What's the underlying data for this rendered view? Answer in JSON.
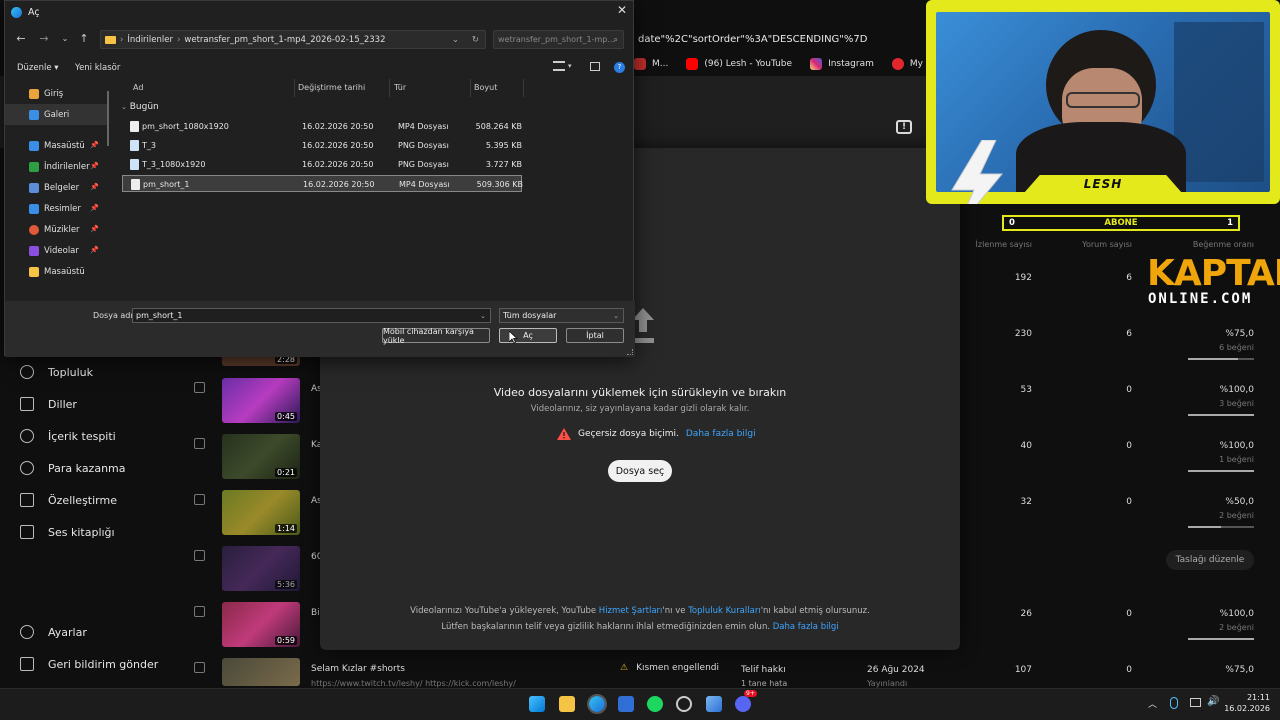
{
  "browser": {
    "url_fragment": "date\"%2C\"sortOrder\"%3A\"DESCENDING\"%7D",
    "bookmarks": [
      {
        "label": "M...",
        "color": "#c4302b"
      },
      {
        "label": "(96) Lesh - YouTube",
        "color": "#ff0000"
      },
      {
        "label": "Instagram",
        "color": "#d62976"
      },
      {
        "label": "My Blerps Dashboa...",
        "color": "#e3262e"
      }
    ]
  },
  "left_nav": {
    "items": [
      {
        "label": "Topluluk",
        "icon": "community-icon"
      },
      {
        "label": "Diller",
        "icon": "subtitles-icon"
      },
      {
        "label": "İçerik tespiti",
        "icon": "copyright-icon"
      },
      {
        "label": "Para kazanma",
        "icon": "dollar-icon"
      },
      {
        "label": "Özelleştirme",
        "icon": "customize-icon"
      },
      {
        "label": "Ses kitaplığı",
        "icon": "audio-library-icon"
      }
    ],
    "settings": "Ayarlar",
    "feedback": "Geri bildirim gönder"
  },
  "content_rows": [
    {
      "duration": "2:28",
      "title": "",
      "views": "230",
      "comments": "6",
      "ratio": "%75,0",
      "likes": "6 beğeni",
      "ratio_value": 0.75
    },
    {
      "duration": "0:45",
      "title": "As",
      "views": "53",
      "comments": "0",
      "ratio": "%100,0",
      "likes": "3 beğeni",
      "ratio_value": 1.0
    },
    {
      "duration": "0:21",
      "title": "Ka",
      "views": "40",
      "comments": "0",
      "ratio": "%100,0",
      "likes": "1 beğeni",
      "ratio_value": 1.0
    },
    {
      "duration": "1:14",
      "title": "As",
      "views": "32",
      "comments": "0",
      "ratio": "%50,0",
      "likes": "2 beğeni",
      "ratio_value": 0.5
    },
    {
      "duration": "5:36",
      "title": "60",
      "views": "",
      "comments": "",
      "ratio": "",
      "likes": "",
      "ratio_value": 0
    },
    {
      "duration": "0:59",
      "title": "Bi",
      "views": "26",
      "comments": "0",
      "ratio": "%100,0",
      "likes": "2 beğeni",
      "ratio_value": 1.0
    }
  ],
  "top_row": {
    "views": "192",
    "comments": "6"
  },
  "last_row": {
    "title": "Selam Kızlar #shorts",
    "desc": "https://www.twitch.tv/leshy/ https://kick.com/leshy/",
    "restriction": "Kısmen engellendi",
    "restriction_sub": "Telif hakkı",
    "restriction_sub2": "1 tane hata",
    "date": "26 Ağu 2024",
    "date_sub": "Yayınlandı",
    "views": "107",
    "comments": "0",
    "ratio": "%75,0"
  },
  "draft_button": "Taslağı düzenle",
  "table_headers": {
    "views": "İzlenme sayısı",
    "comments": "Yorum sayısı",
    "ratio": "Beğenme oranı"
  },
  "upload_modal": {
    "title": "Video dosyalarını yüklemek için sürükleyin ve bırakın",
    "subtitle": "Videolarınız, siz yayınlayana kadar gizli olarak kalır.",
    "error": "Geçersiz dosya biçimi.",
    "error_link": "Daha fazla bilgi",
    "select_button": "Dosya seç",
    "footer1_a": "Videolarınızı YouTube'a yükleyerek, YouTube",
    "footer1_link1": "Hizmet Şartları",
    "footer1_b": "'nı ve",
    "footer1_link2": "Topluluk Kuralları",
    "footer1_c": "'nı kabul etmiş olursunuz.",
    "footer2_a": "Lütfen başkalarının telif veya gizlilik haklarını ihlal etmediğinizden emin olun.",
    "footer2_link": "Daha fazla bilgi"
  },
  "dialog": {
    "title": "Aç",
    "path": [
      "İndirilenler",
      "wetransfer_pm_short_1-mp4_2026-02-15_2332"
    ],
    "search_placeholder": "wetransfer_pm_short_1-mp...",
    "organize": "Düzenle",
    "new_folder": "Yeni klasör",
    "sidebar": [
      {
        "label": "Giriş",
        "color": "#e8a33d",
        "pinned": false
      },
      {
        "label": "Galeri",
        "color": "#3a8ee6",
        "pinned": false
      },
      {
        "label": "Masaüstü",
        "color": "#3a8ee6",
        "pinned": true
      },
      {
        "label": "İndirilenler",
        "color": "#2ea043",
        "pinned": true
      },
      {
        "label": "Belgeler",
        "color": "#5b8dd9",
        "pinned": true
      },
      {
        "label": "Resimler",
        "color": "#3a8ee6",
        "pinned": true
      },
      {
        "label": "Müzikler",
        "color": "#e05a3a",
        "pinned": true
      },
      {
        "label": "Videolar",
        "color": "#8a4fe0",
        "pinned": true
      },
      {
        "label": "Masaüstü",
        "color": "#f6c445",
        "pinned": false
      }
    ],
    "columns": {
      "name": "Ad",
      "modified": "Değiştirme tarihi",
      "type": "Tür",
      "size": "Boyut"
    },
    "group": "Bugün",
    "files": [
      {
        "name": "pm_short_1080x1920",
        "modified": "16.02.2026 20:50",
        "type": "MP4 Dosyası",
        "size": "508.264 KB"
      },
      {
        "name": "T_3",
        "modified": "16.02.2026 20:50",
        "type": "PNG Dosyası",
        "size": "5.395 KB"
      },
      {
        "name": "T_3_1080x1920",
        "modified": "16.02.2026 20:50",
        "type": "PNG Dosyası",
        "size": "3.727 KB"
      },
      {
        "name": "pm_short_1",
        "modified": "16.02.2026 20:50",
        "type": "MP4 Dosyası",
        "size": "509.306 KB"
      }
    ],
    "filename_label": "Dosya adı:",
    "filename_value": "pm_short_1",
    "filter_value": "Tüm dosyalar",
    "mobile_button": "Mobil cihazdan karşıya yükle",
    "open_button": "Aç",
    "cancel_button": "İptal"
  },
  "stream_overlay": {
    "name": "LESH",
    "sub_left": "0",
    "sub_label": "ABONE",
    "sub_right": "1",
    "logo_top": "KAPTAN",
    "logo_bottom": "ONLINE.COM"
  },
  "taskbar": {
    "time": "21:11",
    "date": "16.02.2026",
    "notification_badge": "9+"
  }
}
